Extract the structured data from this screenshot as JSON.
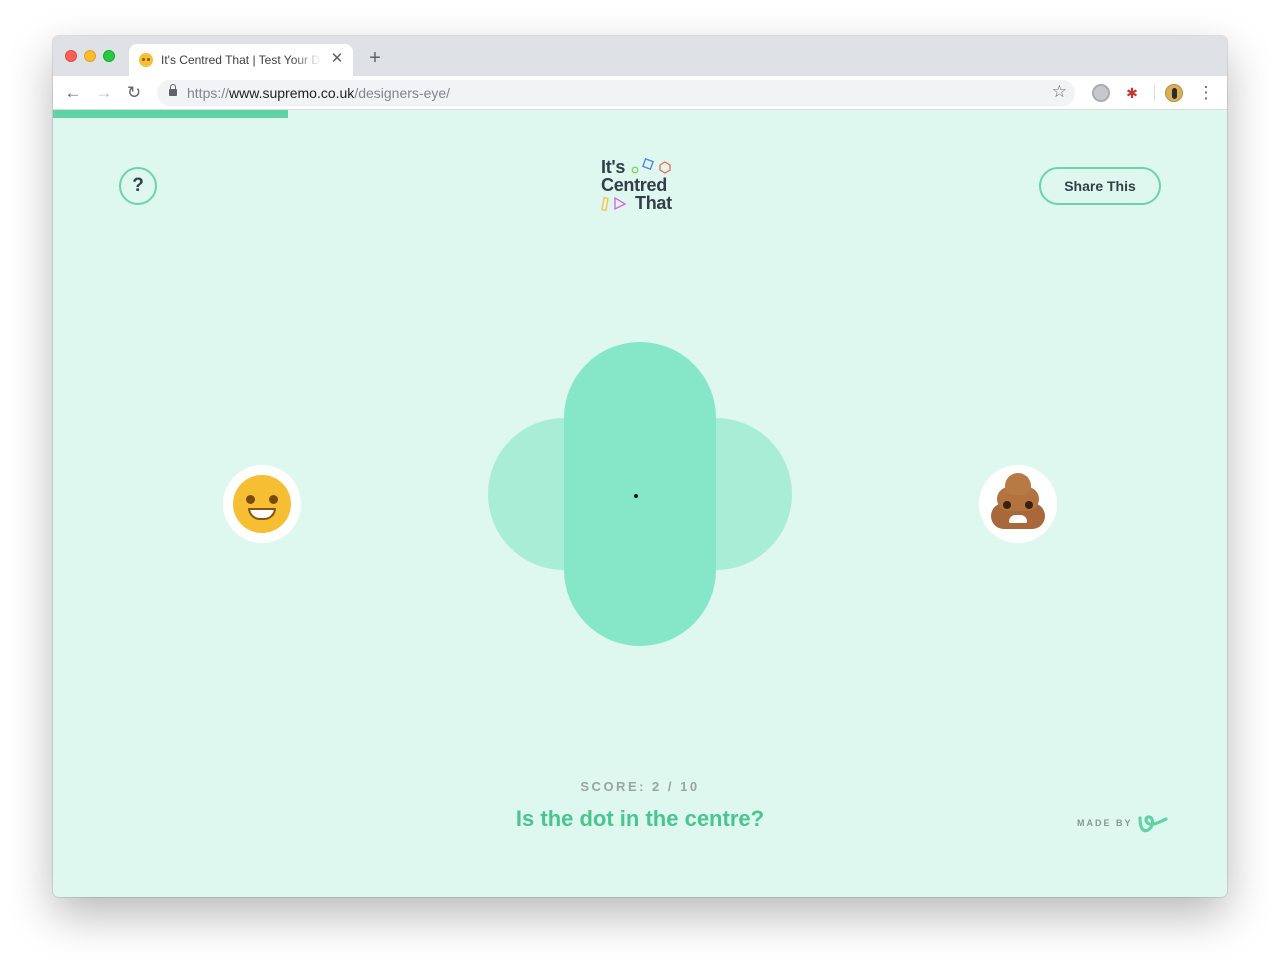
{
  "browser": {
    "tab_title": "It's Centred That | Test Your De",
    "tab_close": "✕",
    "new_tab": "+",
    "url_prefix": "https://",
    "url_domain": "www.supremo.co.uk",
    "url_path": "/designers-eye/",
    "back": "←",
    "forward": "→",
    "reload": "↻",
    "star": "☆",
    "menu": "⋮"
  },
  "game": {
    "logo_lines": [
      "It's",
      "Centred",
      "That"
    ],
    "help_label": "?",
    "share_label": "Share This",
    "score_text": "SCORE: 2 / 10",
    "score": 2,
    "total_questions": 10,
    "progress_fraction": 0.2,
    "question": "Is the dot in the centre?",
    "made_by": "MADE BY",
    "colors": {
      "background": "#def7ef",
      "accent": "#5fd3a3",
      "pill": "#86e7c8",
      "circles": "#a8edd6",
      "question": "#49c58f",
      "text_dark": "#333f48"
    },
    "answers": [
      {
        "name": "yes",
        "icon": "grinning-face-icon"
      },
      {
        "name": "no",
        "icon": "pile-of-poo-icon"
      }
    ]
  }
}
